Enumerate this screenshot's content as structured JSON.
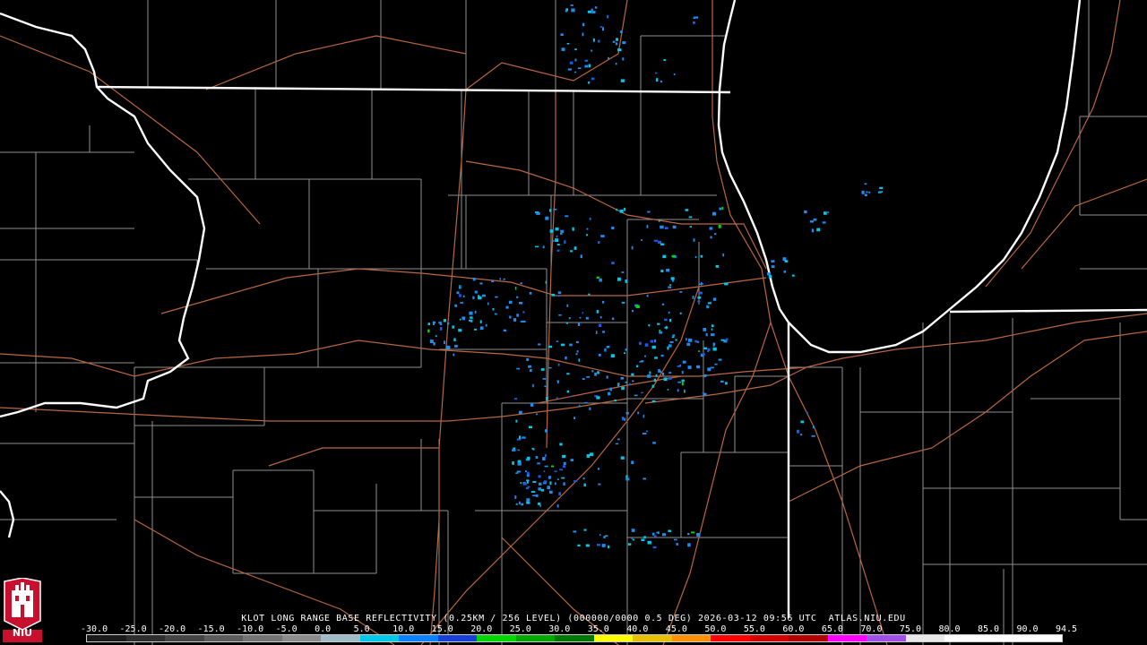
{
  "product": {
    "caption": "KLOT LONG RANGE BASE REFLECTIVITY (0.25KM / 256 LEVEL) (000000/0000 0.5 DEG) 2026-03-12 09:56 UTC  ATLAS.NIU.EDU"
  },
  "legend": {
    "values": [
      "-30.0",
      "-25.0",
      "-20.0",
      "-15.0",
      "-10.0",
      "-5.0",
      "0.0",
      "5.0",
      "10.0",
      "15.0",
      "20.0",
      "25.0",
      "30.0",
      "35.0",
      "40.0",
      "45.0",
      "50.0",
      "55.0",
      "60.0",
      "65.0",
      "70.0",
      "75.0",
      "80.0",
      "85.0",
      "90.0",
      "94.5"
    ],
    "colors": [
      "#1a1a1a",
      "#2e2e2e",
      "#444444",
      "#5c5c5c",
      "#747474",
      "#8c8c8c",
      "#9fbcc8",
      "#00c8e8",
      "#0a82ff",
      "#1840d8",
      "#00d800",
      "#00a800",
      "#007800",
      "#ffff00",
      "#e8c000",
      "#ff9000",
      "#ff0000",
      "#d40000",
      "#b00000",
      "#ff00ff",
      "#a050e8",
      "#e8e8e8",
      "#ffffff",
      "#ffffff",
      "#ffffff"
    ]
  },
  "logo": {
    "text": "NIU"
  },
  "map": {
    "background": "#000000",
    "county_color": "#8f8f8f",
    "state_color": "#ffffff",
    "road_color": "#b9673f",
    "echo_colors": [
      "#1f8cf0",
      "#00c8e8",
      "#1a5ce8",
      "#00d800"
    ]
  }
}
